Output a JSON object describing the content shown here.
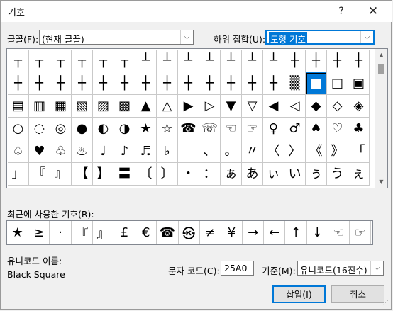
{
  "dialog": {
    "title": "기호",
    "help_glyph": "?",
    "close_glyph": "✕"
  },
  "font": {
    "label": "글꼴(F):",
    "value": "(현재 글꼴)"
  },
  "subset": {
    "label": "하위 집합(U):",
    "value": "도형 기호"
  },
  "symbols": [
    "┬",
    "┬",
    "┬",
    "┬",
    "┬",
    "┬",
    "┴",
    "┴",
    "┴",
    "┴",
    "┴",
    "┴",
    "┴",
    "┼",
    "┼",
    "┼",
    "┼",
    "┼",
    "┼",
    "┼",
    "┼",
    "┼",
    "┼",
    "┼",
    "┼",
    "┼",
    "┼",
    "┼",
    "┼",
    "┼",
    "▒",
    "■",
    "□",
    "▣",
    "▤",
    "▥",
    "▦",
    "▧",
    "▨",
    "▩",
    "▲",
    "△",
    "▶",
    "▷",
    "▼",
    "▽",
    "◀",
    "◁",
    "◆",
    "◇",
    "◈",
    "○",
    "◌",
    "◎",
    "●",
    "◐",
    "◑",
    "★",
    "☆",
    "☎",
    "☏",
    "☜",
    "☞",
    "♀",
    "♂",
    "♠",
    "♡",
    "♣",
    "♤",
    "♥",
    "♧",
    "♨",
    "♩",
    "♪",
    "♬",
    "♭",
    "",
    "、",
    "。",
    "〃",
    "〈",
    "〉",
    "《",
    "》",
    "「",
    "」",
    "『",
    "』",
    "【",
    "】",
    "〓",
    "〔",
    "〕",
    "・",
    "：",
    "ぁ",
    "あ",
    "ぃ",
    "い",
    "ぅ",
    "う",
    "ぇ"
  ],
  "selected_index": 31,
  "recent": {
    "label": "최근에 사용한 기호(R):",
    "symbols": [
      "★",
      "≥",
      "·",
      "『",
      "』",
      "£",
      "€",
      "☎",
      "㉿",
      "≠",
      "¥",
      "→",
      "←",
      "↑",
      "↓",
      "☜",
      "☞"
    ]
  },
  "unicode": {
    "name_label": "유니코드 이름:",
    "name_value": "Black Square",
    "code_label": "문자 코드(C):",
    "code_value": "25A0",
    "base_label": "기준(M):",
    "base_value": "유니코드(16진수)"
  },
  "buttons": {
    "insert": "삽입(I)",
    "cancel": "취소"
  }
}
